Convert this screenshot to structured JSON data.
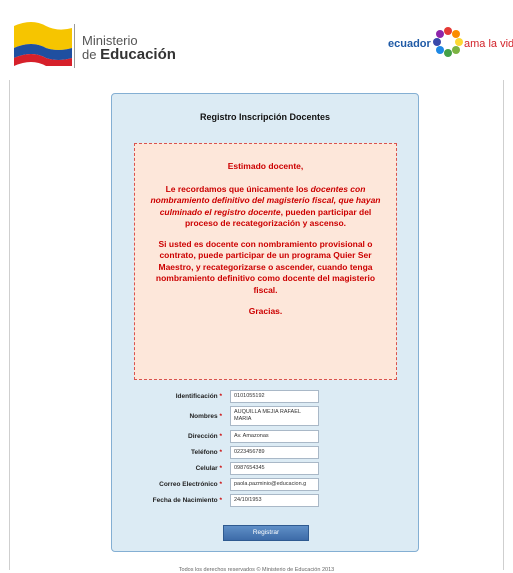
{
  "header": {
    "ministry_line1": "Ministerio",
    "ministry_line2_prefix": "de ",
    "ministry_line2_bold": "Educación",
    "brand_left": "ecuador",
    "brand_right": "ama la vida"
  },
  "panel": {
    "title": "Registro Inscripción Docentes",
    "notice": {
      "greeting": "Estimado docente,",
      "p2_a": "Le recordamos que únicamente los ",
      "p2_b": "docentes con nombramiento definitivo del magisterio fiscal, que hayan culminado el registro docente",
      "p2_c": ", pueden participar del proceso de recategorización y ascenso.",
      "p3": "Si usted es docente con nombramiento provisional o contrato, puede participar de un programa Quier Ser Maestro, y recategorizarse o ascender, cuando tenga nombramiento definitivo como docente del magisterio fiscal.",
      "thanks": "Gracias."
    }
  },
  "form": {
    "required_mark": "*",
    "fields": [
      {
        "label": "Identificación",
        "value": "0101055192"
      },
      {
        "label": "Nombres",
        "value": "AUQUILLA MEJIA RAFAEL MARIA"
      },
      {
        "label": "Dirección",
        "value": "Av. Amazonas"
      },
      {
        "label": "Teléfono",
        "value": "0223456789"
      },
      {
        "label": "Celular",
        "value": "0987654345"
      },
      {
        "label": "Correo Electrónico",
        "value": "paola.pazminio@educacion.g"
      },
      {
        "label": "Fecha de Nacimiento",
        "value": "24/10/1953"
      }
    ],
    "submit_label": "Registrar"
  },
  "footer": {
    "text": "Todos los derechos reservados © Ministerio de Educación 2013"
  },
  "colors": {
    "notice_text": "#cc0000",
    "panel_bg": "#dcebf4",
    "notice_bg": "#fde7da",
    "button": "#3d6ba8"
  }
}
